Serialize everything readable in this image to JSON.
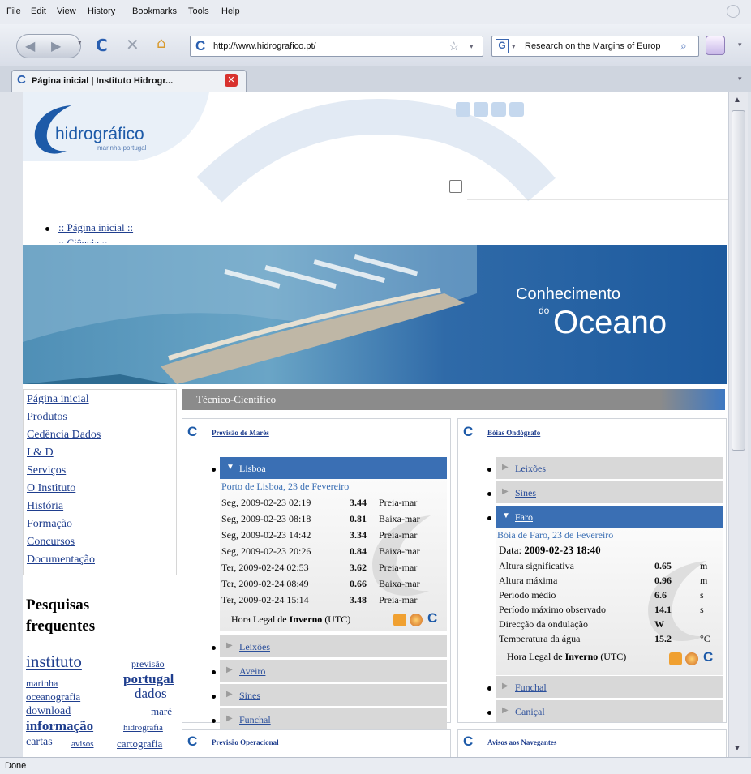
{
  "menu": [
    "File",
    "Edit",
    "View",
    "History",
    "Bookmarks",
    "Tools",
    "Help"
  ],
  "nav": {
    "url": "http://www.hidrografico.pt/",
    "search": "Research on the Margins of Europ"
  },
  "tab": {
    "title": "Página inicial | Instituto Hidrogr..."
  },
  "status": "Done",
  "site": {
    "logo_main": "hidrográfico",
    "logo_sub": "marinha-portugal",
    "topnav": [
      ":: Página inicial ::",
      ":: Ciência ::"
    ],
    "banner_small": "Conhecimento",
    "banner_do": "do",
    "banner_big": "Oceano"
  },
  "sidebar": {
    "items": [
      "Página inicial",
      "Produtos",
      "Cedência Dados",
      "I & D",
      "Serviços",
      "O Instituto",
      "História",
      "Formação",
      "Concursos",
      "Documentação"
    ],
    "search_title_1": "Pesquisas",
    "search_title_2": "frequentes",
    "tags": [
      "instituto",
      "previsão",
      "marinha",
      "portugal",
      "oceanografia",
      "dados",
      "download",
      "maré",
      "informação",
      "hidrografia",
      "cartas",
      "avisos",
      "cartografia"
    ]
  },
  "section_title": "Técnico-Científico",
  "tides": {
    "title": "Previsão de Marés",
    "active": "Lisboa",
    "subtitle": "Porto de Lisboa, 23 de Fevereiro",
    "rows": [
      {
        "d": "Seg, 2009-02-23 02:19",
        "v": "3.44",
        "t": "Preia-mar"
      },
      {
        "d": "Seg, 2009-02-23 08:18",
        "v": "0.81",
        "t": "Baixa-mar"
      },
      {
        "d": "Seg, 2009-02-23 14:42",
        "v": "3.34",
        "t": "Preia-mar"
      },
      {
        "d": "Seg, 2009-02-23 20:26",
        "v": "0.84",
        "t": "Baixa-mar"
      },
      {
        "d": "Ter, 2009-02-24 02:53",
        "v": "3.62",
        "t": "Preia-mar"
      },
      {
        "d": "Ter, 2009-02-24 08:49",
        "v": "0.66",
        "t": "Baixa-mar"
      },
      {
        "d": "Ter, 2009-02-24 15:14",
        "v": "3.48",
        "t": "Preia-mar"
      }
    ],
    "footer_a": "Hora Legal de ",
    "footer_b": "Inverno",
    "footer_c": " (UTC)",
    "others": [
      "Leixões",
      "Aveiro",
      "Sines",
      "Funchal"
    ]
  },
  "buoys": {
    "title": "Bóias Ondógrafo",
    "before": [
      "Leixões",
      "Sines"
    ],
    "active": "Faro",
    "subtitle": "Bóia de Faro, 23 de Fevereiro",
    "date_label": "Data: ",
    "date_value": "2009-02-23 18:40",
    "rows": [
      {
        "k": "Altura significativa",
        "v": "0.65",
        "u": "m"
      },
      {
        "k": "Altura máxima",
        "v": "0.96",
        "u": "m"
      },
      {
        "k": "Período médio",
        "v": "6.6",
        "u": "s"
      },
      {
        "k": "Período máximo observado",
        "v": "14.1",
        "u": "s"
      },
      {
        "k": "Direcção da ondulação",
        "v": "W",
        "u": ""
      },
      {
        "k": "Temperatura da água",
        "v": "15.2",
        "u": "°C"
      }
    ],
    "footer_a": "Hora Legal de ",
    "footer_b": "Inverno",
    "footer_c": " (UTC)",
    "after": [
      "Funchal",
      "Caniçal"
    ]
  },
  "bottom_panels": [
    "Previsão Operacional",
    "Avisos aos Navegantes"
  ]
}
